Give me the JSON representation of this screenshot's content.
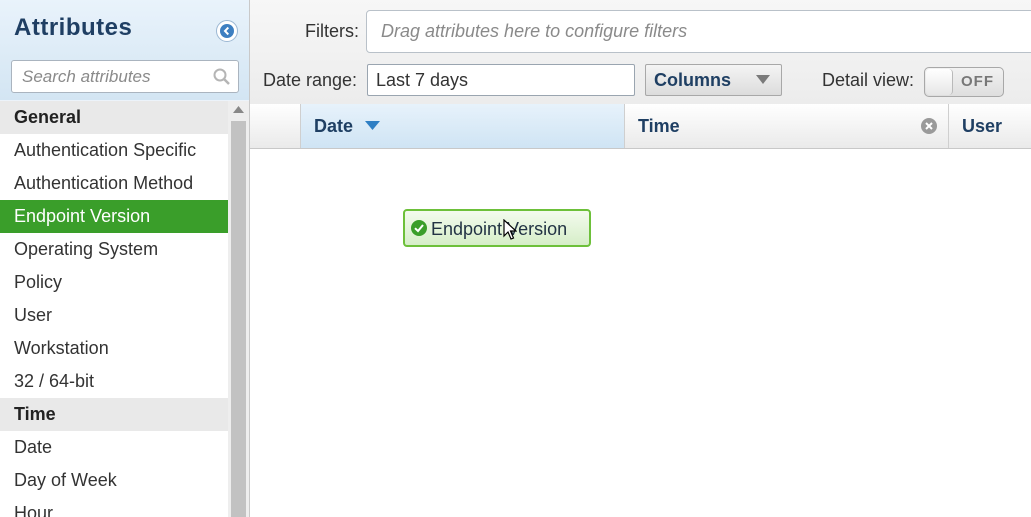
{
  "sidebar": {
    "title": "Attributes",
    "search_placeholder": "Search attributes",
    "groups": [
      {
        "label": "General",
        "items": [
          "Authentication Specific",
          "Authentication Method",
          "Endpoint Version",
          "Operating System",
          "Policy",
          "User",
          "Workstation",
          "32 / 64-bit"
        ]
      },
      {
        "label": "Time",
        "items": [
          "Date",
          "Day of Week",
          "Hour"
        ]
      }
    ],
    "selected_item": "Endpoint Version"
  },
  "toolbar": {
    "filters_label": "Filters:",
    "filters_placeholder": "Drag attributes here to configure filters",
    "date_range_label": "Date range:",
    "date_range_value": "Last 7 days",
    "columns_button": "Columns",
    "detail_view_label": "Detail view:",
    "detail_view_state": "OFF"
  },
  "grid": {
    "columns": [
      "Date",
      "Time",
      "User"
    ],
    "sorted_column": "Date"
  },
  "drag_chip": {
    "label": "Endpoint Version"
  },
  "colors": {
    "accent_green": "#3a9e2a",
    "header_text": "#1f3f63"
  }
}
